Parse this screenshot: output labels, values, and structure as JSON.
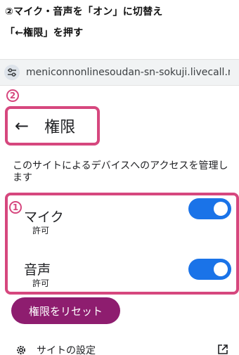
{
  "instructions": {
    "line1": "②マイク・音声を「オン」に切替え",
    "line2": "「←権限」を押す"
  },
  "browser": {
    "url": "meniconon lin esoudan-sn-sokuji.livecall.net/ro",
    "url_display": "meniconnonlinesoudan-sn-sokuji.livecall.net/ro"
  },
  "annotations": {
    "step2_badge": "2",
    "step1_badge": "1"
  },
  "header": {
    "back_symbol": "←",
    "title": "権限"
  },
  "description": "このサイトによるデバイスへのアクセスを管理します",
  "permissions": [
    {
      "name": "マイク",
      "status": "許可",
      "enabled": true
    },
    {
      "name": "音声",
      "status": "許可",
      "enabled": true
    }
  ],
  "reset_button": "権限をリセット",
  "site_settings": "サイトの設定",
  "icons": {
    "url": "tune-icon",
    "back": "back-arrow-icon",
    "settings": "gear-icon",
    "external": "open-in-new-icon"
  },
  "colors": {
    "highlight": "#d6477e",
    "toggle_on": "#1a73e8",
    "reset_button": "#8e1d6f"
  }
}
